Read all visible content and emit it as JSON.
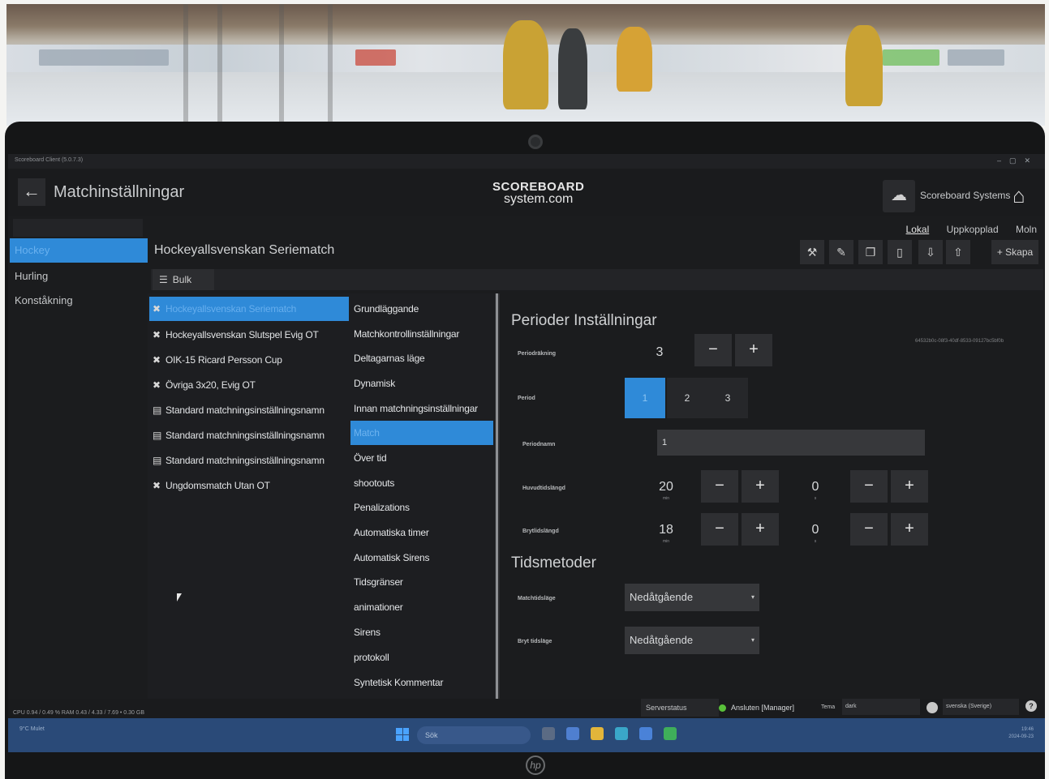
{
  "window": {
    "title": "Scoreboard Client (5.0.7.3)",
    "page_title": "Matchinställningar",
    "logo": {
      "line1": "SCOREBOARD",
      "line2": "system.com"
    },
    "account": "Scoreboard Systems",
    "modes": [
      "Lokal",
      "Uppkopplad",
      "Moln"
    ],
    "active_mode": "Lokal"
  },
  "sports": {
    "items": [
      "Hockey",
      "Hurling",
      "Konståkning"
    ],
    "selected": "Hockey"
  },
  "config": {
    "title": "Hockeyallsvenskan Seriematch",
    "create_label": "Skapa",
    "bulk_label": "Bulk",
    "items": [
      {
        "label": "Hockeyallsvenskan Seriematch",
        "icon": "wrench-cross-icon"
      },
      {
        "label": "Hockeyallsvenskan Slutspel Evig OT",
        "icon": "wrench-cross-icon"
      },
      {
        "label": "OIK-15 Ricard Persson Cup",
        "icon": "wrench-cross-icon"
      },
      {
        "label": "Övriga 3x20, Evig OT",
        "icon": "wrench-cross-icon"
      },
      {
        "label": "Standard matchningsinställningsnamn",
        "icon": "document-icon"
      },
      {
        "label": "Standard matchningsinställningsnamn",
        "icon": "document-icon"
      },
      {
        "label": "Standard matchningsinställningsnamn",
        "icon": "document-icon"
      },
      {
        "label": "Ungdomsmatch Utan OT",
        "icon": "wrench-cross-icon"
      }
    ],
    "selected_index": 0
  },
  "categories": {
    "items": [
      "Grundläggande",
      "Matchkontrollinställningar",
      "Deltagarnas läge",
      "Dynamisk",
      "Innan matchningsinställningar",
      "Match",
      "Över tid",
      "shootouts",
      "Penalizations",
      "Automatiska timer",
      "Automatisk Sirens",
      "Tidsgränser",
      "animationer",
      "Sirens",
      "protokoll",
      "Syntetisk Kommentar"
    ],
    "selected_index": 5
  },
  "panel": {
    "title": "Perioder Inställningar",
    "guid": "64532b0c-08f3-40df-8533-09127bc5bf0b",
    "period_count": {
      "label": "Periodräkning",
      "value": "3"
    },
    "period": {
      "label": "Period",
      "options": [
        "1",
        "2",
        "3"
      ],
      "selected_index": 0
    },
    "period_name": {
      "label": "Periodnamn",
      "value": "1"
    },
    "main_length": {
      "label": "Huvudtidslängd",
      "minutes": "20",
      "minutes_unit": "min",
      "seconds": "0",
      "seconds_unit": "s"
    },
    "break_length": {
      "label": "Brytlidslängd",
      "minutes": "18",
      "minutes_unit": "min",
      "seconds": "0",
      "seconds_unit": "s"
    },
    "time_methods_title": "Tidsmetoder",
    "match_time_mode": {
      "label": "Matchtidsläge",
      "value": "Nedåtgående"
    },
    "break_time_mode": {
      "label": "Bryt tidsläge",
      "value": "Nedåtgående"
    }
  },
  "status": {
    "cpu": "CPU 0.94 / 0.49 % RAM 0.43 / 4.33 / 7.69 • 0.30 GB",
    "server_label": "Serverstatus",
    "connection": "Ansluten [Manager]",
    "connection_color": "#59c03a",
    "theme_label": "Tema",
    "theme_value": "dark",
    "language": "svenska (Sverige)"
  },
  "taskbar": {
    "weather": "9°C Mulet",
    "search": "Sök",
    "clock_time": "19:46",
    "clock_date": "2024-09-23"
  },
  "colors": {
    "accent": "#2f8ad8",
    "background": "#1b1c1e",
    "taskbar": "#2a4a78"
  }
}
